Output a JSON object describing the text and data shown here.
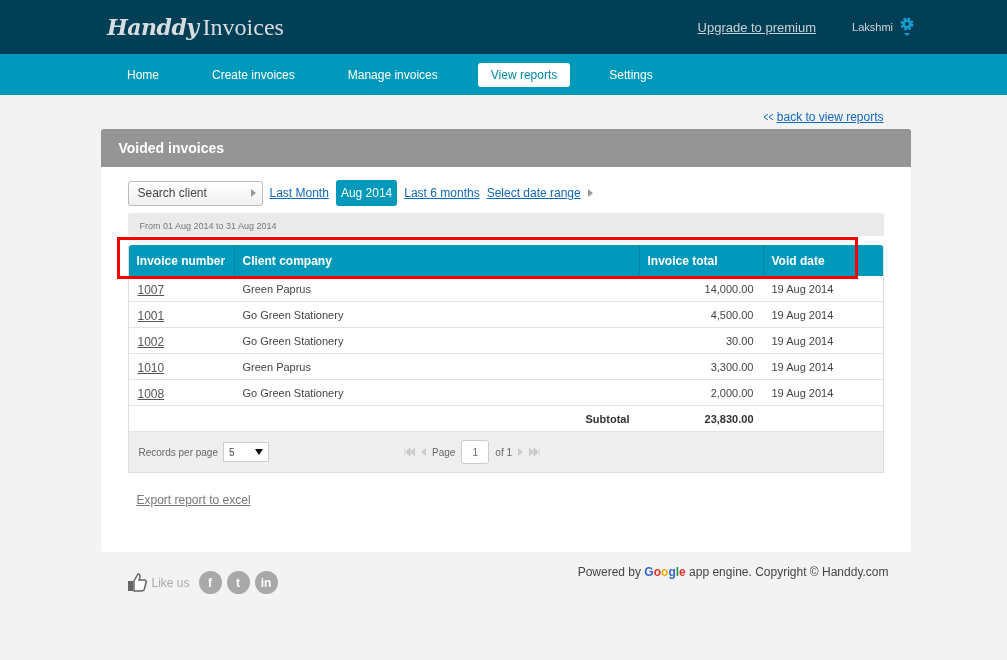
{
  "header": {
    "logo_script": "Handdy",
    "logo_plain": "Invoices",
    "upgrade_link": "Upgrade to premium",
    "user": "Lakshmi"
  },
  "nav": [
    {
      "label": "Home",
      "selected": false
    },
    {
      "label": "Create invoices",
      "selected": false
    },
    {
      "label": "Manage invoices",
      "selected": false
    },
    {
      "label": "View reports",
      "selected": true
    },
    {
      "label": "Settings",
      "selected": false
    }
  ],
  "back_link": "back to view reports",
  "panel": {
    "title": "Voided invoices",
    "search": {
      "placeholder": "Search client"
    },
    "periods": [
      {
        "label": "Last Month",
        "selected": false
      },
      {
        "label": "Aug 2014",
        "selected": true
      },
      {
        "label": "Last 6 months",
        "selected": false
      },
      {
        "label": "Select date range",
        "selected": false
      }
    ],
    "range_text": "From 01 Aug 2014 to 31 Aug 2014",
    "table": {
      "columns": [
        "Invoice number",
        "Client company",
        "Invoice total",
        "Void date"
      ],
      "rows": [
        {
          "number": "1007",
          "client": "Green Paprus",
          "total": "14,000.00",
          "date": "19 Aug 2014"
        },
        {
          "number": "1001",
          "client": "Go Green Stationery",
          "total": "4,500.00",
          "date": "19 Aug 2014"
        },
        {
          "number": "1002",
          "client": "Go Green Stationery",
          "total": "30.00",
          "date": "19 Aug 2014"
        },
        {
          "number": "1010",
          "client": "Green Paprus",
          "total": "3,300.00",
          "date": "19 Aug 2014"
        },
        {
          "number": "1008",
          "client": "Go Green Stationery",
          "total": "2,000.00",
          "date": "19 Aug 2014"
        }
      ],
      "subtotal_label": "Subtotal",
      "subtotal": "23,830.00"
    },
    "pager": {
      "records_label": "Records per page",
      "records_value": "5",
      "page_label": "Page",
      "page_value": "1",
      "of_label": "of 1"
    },
    "export_link": "Export report to excel"
  },
  "footer": {
    "like": "Like us",
    "social": [
      "f",
      "t",
      "in"
    ],
    "powered_by": "Powered by",
    "google": "Google",
    "rest": "app engine. Copyright © Handdy.com"
  }
}
